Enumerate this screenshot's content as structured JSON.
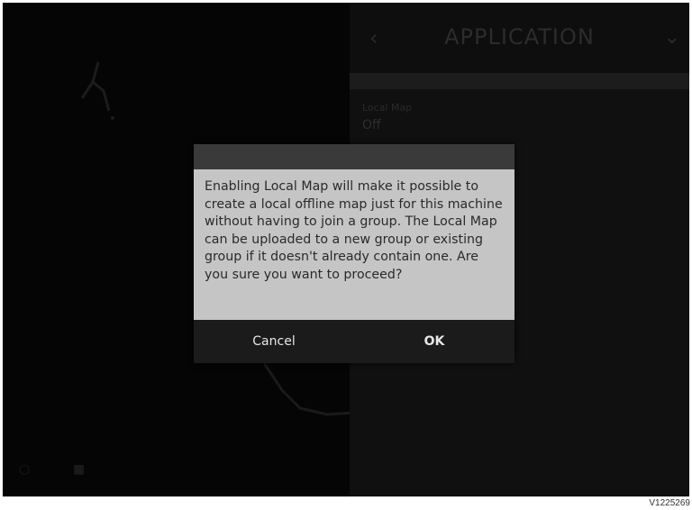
{
  "panel": {
    "title": "APPLICATION",
    "back_icon": "chevron-left-icon",
    "collapse_icon": "chevron-down-icon",
    "setting": {
      "label": "Local Map",
      "value": "Off"
    }
  },
  "map": {
    "marker_icon": "machine-marker-icon",
    "bottom_icons": [
      "locate-icon",
      "layers-icon"
    ]
  },
  "dialog": {
    "message": "Enabling Local Map will make it possible to create a local offline map just for this machine without having to join a group. The Local Map can be uploaded to a new group or existing group if it doesn't already contain one. Are you sure you want to proceed?",
    "cancel_label": "Cancel",
    "ok_label": "OK"
  },
  "footer": {
    "reference_code": "V1225269"
  },
  "colors": {
    "dialog_body": "#c5c5c5",
    "dialog_actions": "#1b1b1b",
    "background": "#060606"
  }
}
